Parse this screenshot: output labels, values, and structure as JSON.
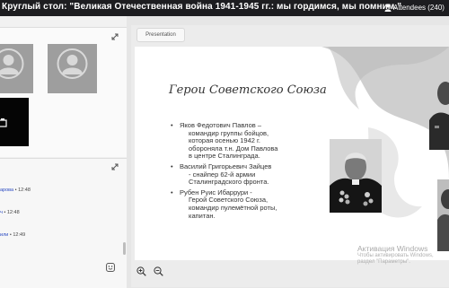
{
  "topbar": {
    "title": "Круглый стол: \"Великая Отечественная война 1941-1945 гг.: мы гордимся, мы помним.\"",
    "attendees": "Attendees (240)"
  },
  "chat": {
    "messages": [
      {
        "name": "арова",
        "time": "12:48"
      },
      {
        "name": "ч",
        "time": "12:48"
      },
      {
        "name": "или",
        "time": "12:49"
      }
    ]
  },
  "presentation": {
    "tab_label": "Presentation",
    "slide_title": "Герои Советского Союза",
    "bullets": [
      {
        "line1": "Яков Федотович Павлов –",
        "rest": [
          "командир группы бойцов,",
          "которая осенью 1942 г.",
          "обороняла т.н. Дом Павлова",
          "в центре Сталинграда."
        ]
      },
      {
        "line1": "Василий Григорьевич Зайцев",
        "rest": [
          "- снайпер 62-й армии",
          "Сталинградского фронта."
        ]
      },
      {
        "line1": "Рубен Руис Ибаррури  -",
        "rest": [
          "Герой Советского Союза,",
          "командир пулемётной роты,",
          "капитан."
        ]
      }
    ]
  },
  "watermark": {
    "line1": "Активация Windows",
    "line2": "Чтобы активировать Windows,",
    "line3": "раздел \"Параметры\"."
  },
  "colors": {
    "topbar": "#1d1d20",
    "name_link": "#2b4bc2",
    "accent": "#2d6ed8"
  }
}
